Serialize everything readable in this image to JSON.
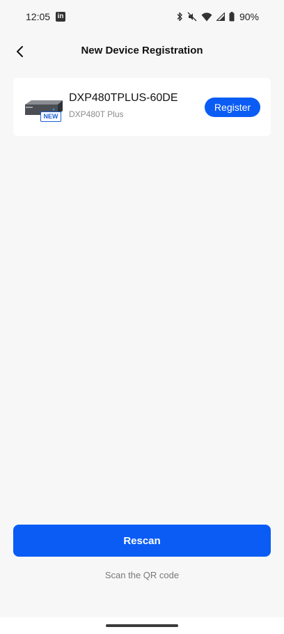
{
  "status_bar": {
    "time": "12:05",
    "notification_icon": "linkedin-icon",
    "notification_glyph": "in",
    "battery": "90%",
    "icons": [
      "bluetooth-icon",
      "mute-icon",
      "wifi-icon",
      "signal-icon",
      "battery-icon"
    ]
  },
  "header": {
    "back_icon": "back-arrow-icon",
    "title": "New Device Registration"
  },
  "device": {
    "name": "DXP480TPLUS-60DE",
    "model": "DXP480T Plus",
    "badge": "NEW",
    "register_label": "Register"
  },
  "actions": {
    "rescan_label": "Rescan",
    "qr_label": "Scan the QR code"
  },
  "colors": {
    "accent": "#0a5cf5",
    "background": "#f7f7f7",
    "card": "#ffffff"
  }
}
